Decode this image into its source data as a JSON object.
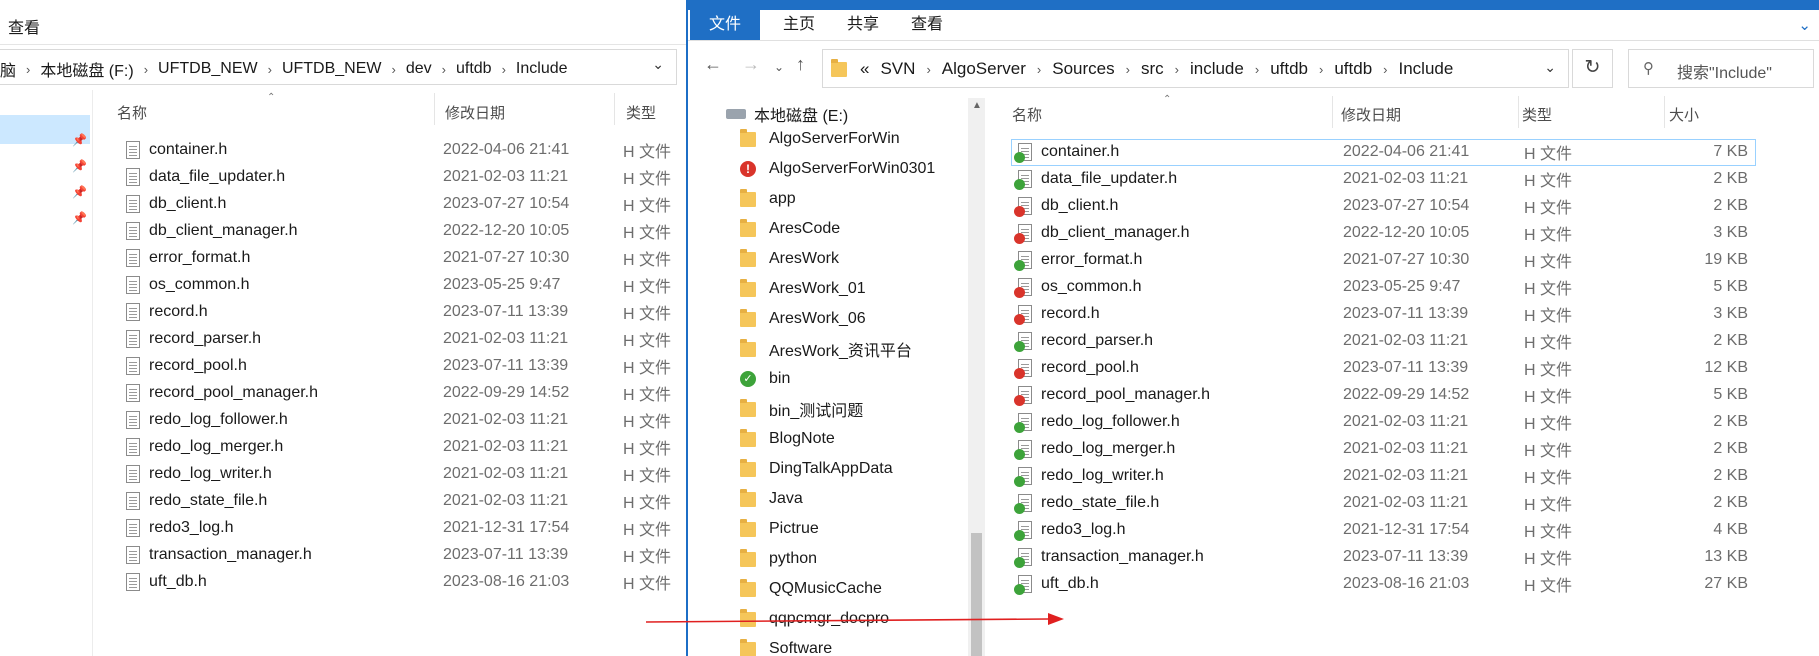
{
  "left": {
    "ribbon_tab": "查看",
    "breadcrumb": [
      "脑",
      "本地磁盘 (F:)",
      "UFTDB_NEW",
      "UFTDB_NEW",
      "dev",
      "uftdb",
      "Include"
    ],
    "columns": {
      "name": "名称",
      "date": "修改日期",
      "type": "类型"
    },
    "files": [
      {
        "name": "container.h",
        "date": "2022-04-06 21:41",
        "type": "H 文件"
      },
      {
        "name": "data_file_updater.h",
        "date": "2021-02-03 11:21",
        "type": "H 文件"
      },
      {
        "name": "db_client.h",
        "date": "2023-07-27 10:54",
        "type": "H 文件"
      },
      {
        "name": "db_client_manager.h",
        "date": "2022-12-20 10:05",
        "type": "H 文件"
      },
      {
        "name": "error_format.h",
        "date": "2021-07-27 10:30",
        "type": "H 文件"
      },
      {
        "name": "os_common.h",
        "date": "2023-05-25 9:47",
        "type": "H 文件"
      },
      {
        "name": "record.h",
        "date": "2023-07-11 13:39",
        "type": "H 文件"
      },
      {
        "name": "record_parser.h",
        "date": "2021-02-03 11:21",
        "type": "H 文件"
      },
      {
        "name": "record_pool.h",
        "date": "2023-07-11 13:39",
        "type": "H 文件"
      },
      {
        "name": "record_pool_manager.h",
        "date": "2022-09-29 14:52",
        "type": "H 文件"
      },
      {
        "name": "redo_log_follower.h",
        "date": "2021-02-03 11:21",
        "type": "H 文件"
      },
      {
        "name": "redo_log_merger.h",
        "date": "2021-02-03 11:21",
        "type": "H 文件"
      },
      {
        "name": "redo_log_writer.h",
        "date": "2021-02-03 11:21",
        "type": "H 文件"
      },
      {
        "name": "redo_state_file.h",
        "date": "2021-02-03 11:21",
        "type": "H 文件"
      },
      {
        "name": "redo3_log.h",
        "date": "2021-12-31 17:54",
        "type": "H 文件"
      },
      {
        "name": "transaction_manager.h",
        "date": "2023-07-11 13:39",
        "type": "H 文件"
      },
      {
        "name": "uft_db.h",
        "date": "2023-08-16 21:03",
        "type": "H 文件"
      }
    ]
  },
  "right": {
    "ribbon_tabs": {
      "file": "文件",
      "home": "主页",
      "share": "共享",
      "view": "查看"
    },
    "address": [
      "«",
      "SVN",
      "AlgoServer",
      "Sources",
      "src",
      "include",
      "uftdb",
      "uftdb",
      "Include"
    ],
    "search_placeholder": "搜索\"Include\"",
    "tree": [
      {
        "name": "本地磁盘 (E:)",
        "icon": "drive"
      },
      {
        "name": "AlgoServerForWin",
        "icon": "folder"
      },
      {
        "name": "AlgoServerForWin0301",
        "icon": "svn-modified"
      },
      {
        "name": "app",
        "icon": "folder"
      },
      {
        "name": "AresCode",
        "icon": "folder"
      },
      {
        "name": "AresWork",
        "icon": "folder"
      },
      {
        "name": "AresWork_01",
        "icon": "folder"
      },
      {
        "name": "AresWork_06",
        "icon": "folder"
      },
      {
        "name": "AresWork_资讯平台",
        "icon": "folder"
      },
      {
        "name": "bin",
        "icon": "svn-ok"
      },
      {
        "name": "bin_测试问题",
        "icon": "folder"
      },
      {
        "name": "BlogNote",
        "icon": "folder"
      },
      {
        "name": "DingTalkAppData",
        "icon": "folder"
      },
      {
        "name": "Java",
        "icon": "folder"
      },
      {
        "name": "Pictrue",
        "icon": "folder"
      },
      {
        "name": "python",
        "icon": "folder"
      },
      {
        "name": "QQMusicCache",
        "icon": "folder"
      },
      {
        "name": "qqpcmgr_docpro",
        "icon": "folder"
      },
      {
        "name": "Software",
        "icon": "folder"
      }
    ],
    "columns": {
      "name": "名称",
      "date": "修改日期",
      "type": "类型",
      "size": "大小"
    },
    "files": [
      {
        "name": "container.h",
        "date": "2022-04-06 21:41",
        "type": "H 文件",
        "size": "7 KB",
        "status": "ok"
      },
      {
        "name": "data_file_updater.h",
        "date": "2021-02-03 11:21",
        "type": "H 文件",
        "size": "2 KB",
        "status": "ok"
      },
      {
        "name": "db_client.h",
        "date": "2023-07-27 10:54",
        "type": "H 文件",
        "size": "2 KB",
        "status": "mod"
      },
      {
        "name": "db_client_manager.h",
        "date": "2022-12-20 10:05",
        "type": "H 文件",
        "size": "3 KB",
        "status": "mod"
      },
      {
        "name": "error_format.h",
        "date": "2021-07-27 10:30",
        "type": "H 文件",
        "size": "19 KB",
        "status": "ok"
      },
      {
        "name": "os_common.h",
        "date": "2023-05-25 9:47",
        "type": "H 文件",
        "size": "5 KB",
        "status": "mod"
      },
      {
        "name": "record.h",
        "date": "2023-07-11 13:39",
        "type": "H 文件",
        "size": "3 KB",
        "status": "mod"
      },
      {
        "name": "record_parser.h",
        "date": "2021-02-03 11:21",
        "type": "H 文件",
        "size": "2 KB",
        "status": "ok"
      },
      {
        "name": "record_pool.h",
        "date": "2023-07-11 13:39",
        "type": "H 文件",
        "size": "12 KB",
        "status": "mod"
      },
      {
        "name": "record_pool_manager.h",
        "date": "2022-09-29 14:52",
        "type": "H 文件",
        "size": "5 KB",
        "status": "mod"
      },
      {
        "name": "redo_log_follower.h",
        "date": "2021-02-03 11:21",
        "type": "H 文件",
        "size": "2 KB",
        "status": "ok"
      },
      {
        "name": "redo_log_merger.h",
        "date": "2021-02-03 11:21",
        "type": "H 文件",
        "size": "2 KB",
        "status": "ok"
      },
      {
        "name": "redo_log_writer.h",
        "date": "2021-02-03 11:21",
        "type": "H 文件",
        "size": "2 KB",
        "status": "ok"
      },
      {
        "name": "redo_state_file.h",
        "date": "2021-02-03 11:21",
        "type": "H 文件",
        "size": "2 KB",
        "status": "ok"
      },
      {
        "name": "redo3_log.h",
        "date": "2021-12-31 17:54",
        "type": "H 文件",
        "size": "4 KB",
        "status": "ok"
      },
      {
        "name": "transaction_manager.h",
        "date": "2023-07-11 13:39",
        "type": "H 文件",
        "size": "13 KB",
        "status": "ok"
      },
      {
        "name": "uft_db.h",
        "date": "2023-08-16 21:03",
        "type": "H 文件",
        "size": "27 KB",
        "status": "ok"
      }
    ]
  },
  "annotation": {
    "arrow_color": "#e02020"
  }
}
